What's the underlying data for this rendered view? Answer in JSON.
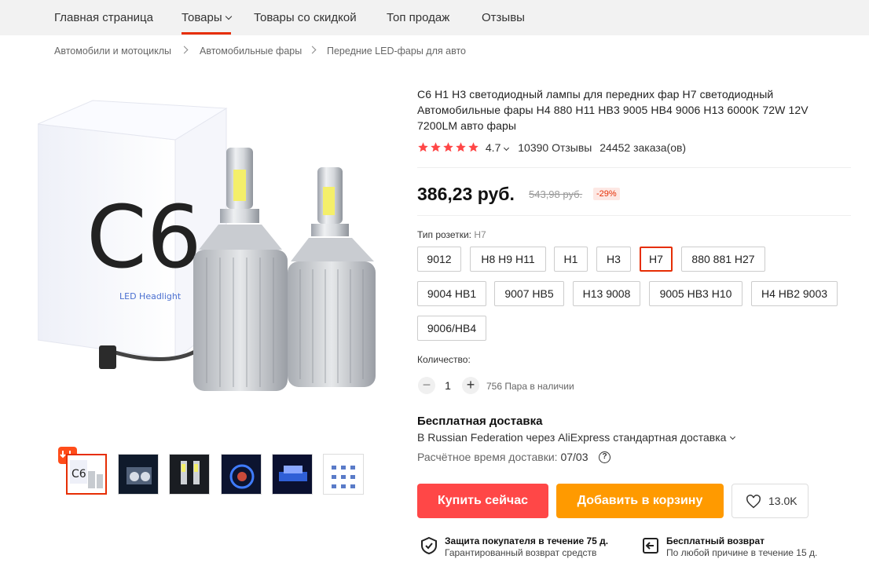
{
  "nav": {
    "items": [
      {
        "label": "Главная страница"
      },
      {
        "label": "Товары"
      },
      {
        "label": "Товары со скидкой"
      },
      {
        "label": "Топ продаж"
      },
      {
        "label": "Отзывы"
      }
    ],
    "active": "Товары"
  },
  "breadcrumb": [
    "Автомобили и мотоциклы",
    "Автомобильные фары",
    "Передние LED-фары для авто"
  ],
  "product": {
    "title": "C6 H1 H3 светодиодный лампы для передних фар H7 светодиодный Автомобильные фары H4 880 H11 HB3 9005 HB4 9006 H13 6000K 72W 12V 7200LM авто фары",
    "image_text": {
      "logo": "C6",
      "box_line": "LED Headlight"
    },
    "rating": "4.7",
    "reviews": "10390 Отзывы",
    "orders": "24452 заказа(ов)",
    "price": "386,23 руб.",
    "old_price": "543,98 руб.",
    "discount": "-29%"
  },
  "socket": {
    "label": "Тип розетки:",
    "selected": "H7",
    "options": [
      "9012",
      "H8 H9 H11",
      "H1",
      "H3",
      "H7",
      "880 881 H27",
      "9004 HB1",
      "9007 HB5",
      "H13 9008",
      "9005 HB3 H10",
      "H4 HB2 9003",
      "9006/HB4"
    ]
  },
  "quantity": {
    "label": "Количество:",
    "value": "1",
    "minus": "−",
    "plus": "+",
    "stock": "756 Пара в наличии"
  },
  "shipping": {
    "title": "Бесплатная доставка",
    "line": "В Russian Federation через AliExpress стандартная доставка",
    "time_label": "Расчётное время доставки:",
    "time_value": "07/03",
    "help": "?"
  },
  "actions": {
    "buy": "Купить сейчас",
    "cart": "Добавить в корзину",
    "wishlist_count": "13.0K"
  },
  "guarantees": [
    {
      "title": "Защита покупателя в течение 75 д.",
      "subtitle": "Гарантированный возврат средств"
    },
    {
      "title": "Бесплатный возврат",
      "subtitle": "По любой причине в течение 15 д."
    }
  ],
  "colors": {
    "accent": "#e62e04",
    "buy": "#ff4747",
    "cart": "#ff9a00",
    "star": "#ff4747"
  }
}
